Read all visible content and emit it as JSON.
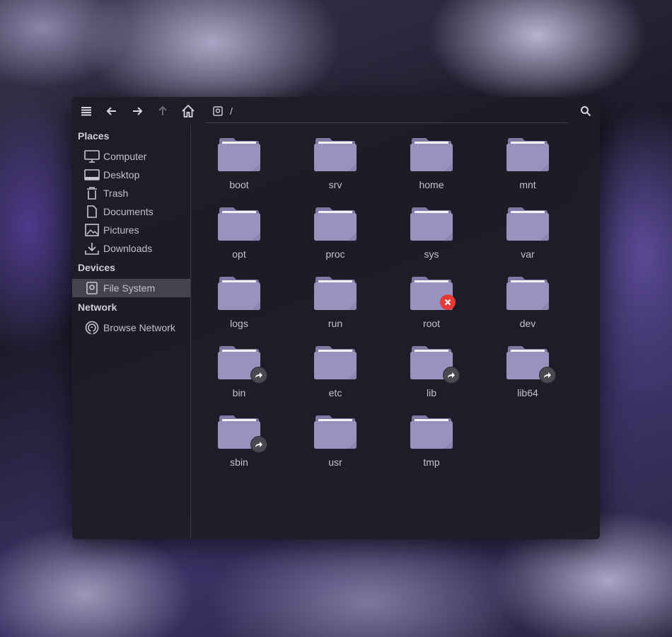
{
  "window": {
    "toolbar": {
      "menu_icon": "hamburger-menu-icon",
      "back_icon": "arrow-left-icon",
      "forward_icon": "arrow-right-icon",
      "up_icon": "arrow-up-icon",
      "home_icon": "home-icon",
      "search_icon": "search-icon"
    },
    "pathbar": {
      "icon": "drive-icon",
      "path": "/"
    }
  },
  "sidebar": {
    "places_header": "Places",
    "places": [
      {
        "label": "Computer",
        "icon": "monitor-icon"
      },
      {
        "label": "Desktop",
        "icon": "desktop-icon"
      },
      {
        "label": "Trash",
        "icon": "trash-icon"
      },
      {
        "label": "Documents",
        "icon": "document-icon"
      },
      {
        "label": "Pictures",
        "icon": "picture-icon"
      },
      {
        "label": "Downloads",
        "icon": "download-icon"
      }
    ],
    "devices_header": "Devices",
    "devices": [
      {
        "label": "File System",
        "icon": "drive-icon",
        "active": true
      }
    ],
    "network_header": "Network",
    "network": [
      {
        "label": "Browse Network",
        "icon": "network-icon"
      }
    ]
  },
  "files": [
    {
      "name": "boot",
      "emblem": ""
    },
    {
      "name": "srv",
      "emblem": ""
    },
    {
      "name": "home",
      "emblem": ""
    },
    {
      "name": "mnt",
      "emblem": ""
    },
    {
      "name": "opt",
      "emblem": ""
    },
    {
      "name": "proc",
      "emblem": ""
    },
    {
      "name": "sys",
      "emblem": ""
    },
    {
      "name": "var",
      "emblem": ""
    },
    {
      "name": "logs",
      "emblem": ""
    },
    {
      "name": "run",
      "emblem": ""
    },
    {
      "name": "root",
      "emblem": "unreadable"
    },
    {
      "name": "dev",
      "emblem": ""
    },
    {
      "name": "bin",
      "emblem": "symlink"
    },
    {
      "name": "etc",
      "emblem": ""
    },
    {
      "name": "lib",
      "emblem": "symlink"
    },
    {
      "name": "lib64",
      "emblem": "symlink"
    },
    {
      "name": "sbin",
      "emblem": "symlink"
    },
    {
      "name": "usr",
      "emblem": ""
    },
    {
      "name": "tmp",
      "emblem": ""
    }
  ],
  "colors": {
    "folder_body": "#9793bd",
    "folder_back": "#7e7aa3",
    "accent_error": "#e53935"
  }
}
